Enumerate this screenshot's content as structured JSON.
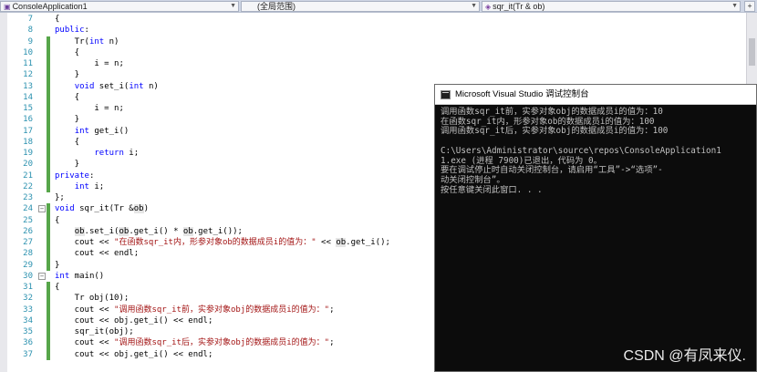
{
  "navbar": {
    "project": "ConsoleApplication1",
    "scope": "(全局范围)",
    "function": "sqr_it(Tr & ob)"
  },
  "code_lines": [
    {
      "n": "7",
      "t": "{"
    },
    {
      "n": "8",
      "t": "public:"
    },
    {
      "n": "9",
      "t": "    Tr(int n)"
    },
    {
      "n": "10",
      "t": "    {"
    },
    {
      "n": "11",
      "t": "        i = n;"
    },
    {
      "n": "12",
      "t": "    }"
    },
    {
      "n": "13",
      "t": "    void set_i(int n)"
    },
    {
      "n": "14",
      "t": "    {"
    },
    {
      "n": "15",
      "t": "        i = n;"
    },
    {
      "n": "16",
      "t": "    }"
    },
    {
      "n": "17",
      "t": "    int get_i()"
    },
    {
      "n": "18",
      "t": "    {"
    },
    {
      "n": "19",
      "t": "        return i;"
    },
    {
      "n": "20",
      "t": "    }"
    },
    {
      "n": "21",
      "t": "private:"
    },
    {
      "n": "22",
      "t": "    int i;"
    },
    {
      "n": "23",
      "t": "};"
    },
    {
      "n": "24",
      "t": "void sqr_it(Tr &ob)"
    },
    {
      "n": "25",
      "t": "{"
    },
    {
      "n": "26",
      "t": "    ob.set_i(ob.get_i() * ob.get_i());"
    },
    {
      "n": "27",
      "t": "    cout << \"在函数sqr_it内，形参对象ob的数据成员i的值为：\" << ob.get_i();"
    },
    {
      "n": "28",
      "t": "    cout << endl;"
    },
    {
      "n": "29",
      "t": "}"
    },
    {
      "n": "30",
      "t": "int main()"
    },
    {
      "n": "31",
      "t": "{"
    },
    {
      "n": "32",
      "t": "    Tr obj(10);"
    },
    {
      "n": "33",
      "t": "    cout << \"调用函数sqr_it前，实参对象obj的数据成员i的值为：\";"
    },
    {
      "n": "34",
      "t": "    cout << obj.get_i() << endl;"
    },
    {
      "n": "35",
      "t": "    sqr_it(obj);"
    },
    {
      "n": "36",
      "t": "    cout << \"调用函数sqr_it后，实参对象obj的数据成员i的值为：\";"
    },
    {
      "n": "37",
      "t": "    cout << obj.get_i() << endl;"
    }
  ],
  "console": {
    "title": "Microsoft Visual Studio 调试控制台",
    "lines": [
      "调用函数sqr_it前，实参对象obj的数据成员i的值为：10",
      "在函数sqr_it内，形参对象ob的数据成员i的值为：100",
      "调用函数sqr_it后，实参对象obj的数据成员i的值为：100",
      "",
      "C:\\Users\\Administrator\\source\\repos\\ConsoleApplication1",
      "1.exe (进程 7900)已退出，代码为 0。",
      "要在调试停止时自动关闭控制台，请启用“工具”->“选项”-",
      "动关闭控制台”。",
      "按任意键关闭此窗口. . ."
    ]
  },
  "watermark": "CSDN @有凤来仪.",
  "colors": {
    "keyword": "#0000ff",
    "string": "#a31515",
    "line_number": "#2b91af",
    "change_marker": "#57a64a",
    "console_bg": "#0c0c0c",
    "console_fg": "#c0c0c0"
  }
}
